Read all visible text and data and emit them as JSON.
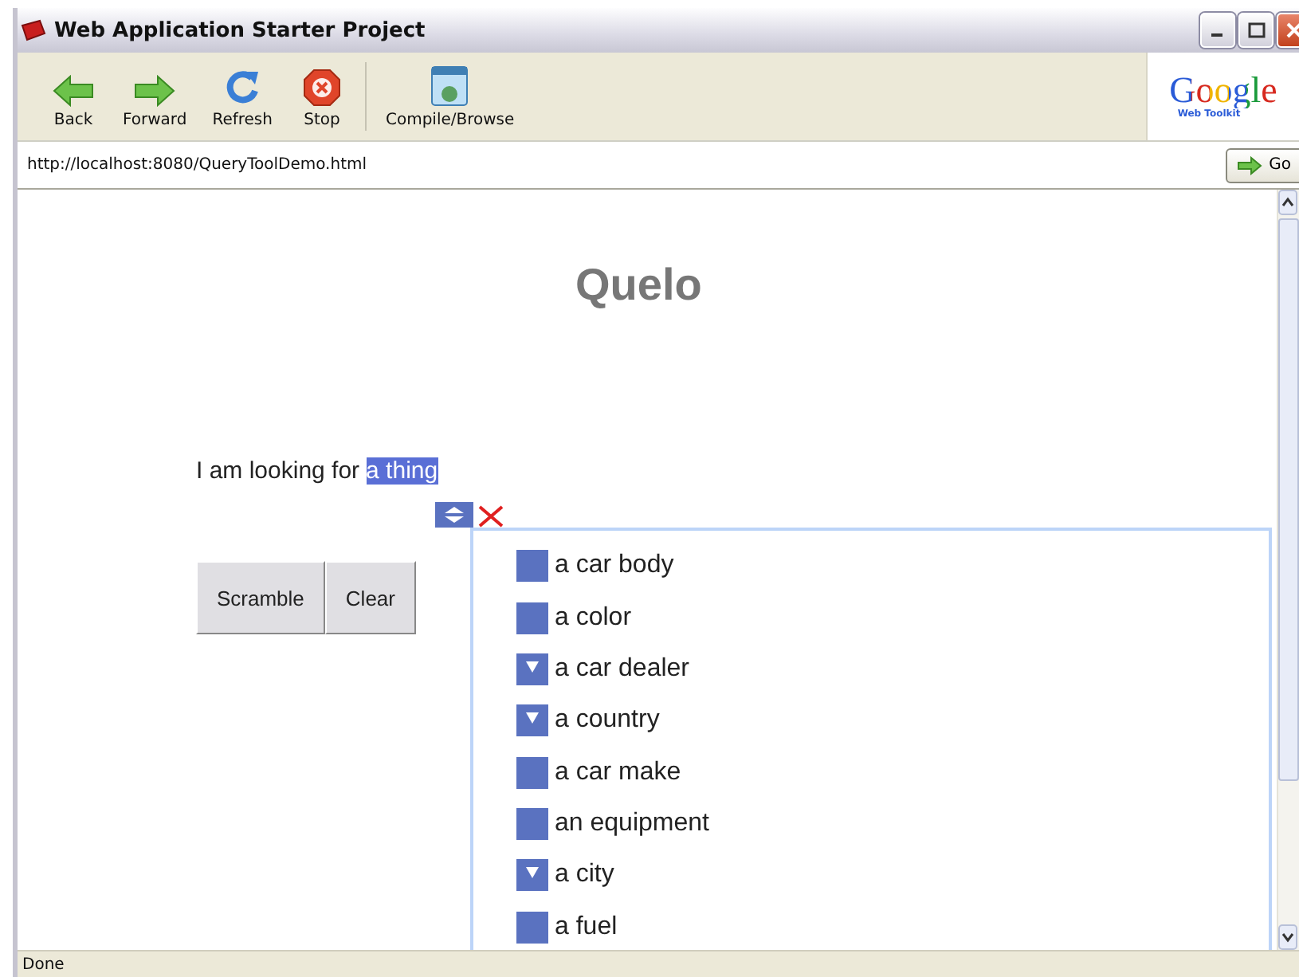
{
  "window": {
    "title": "Web Application Starter Project"
  },
  "toolbar": {
    "buttons": [
      {
        "label": "Back",
        "kind": "back"
      },
      {
        "label": "Forward",
        "kind": "forward"
      },
      {
        "label": "Refresh",
        "kind": "refresh"
      },
      {
        "label": "Stop",
        "kind": "stop"
      },
      {
        "label": "Compile/Browse",
        "kind": "compile"
      }
    ],
    "logo": {
      "name": "Google",
      "subtitle": "Web Toolkit"
    }
  },
  "address_bar": {
    "url": "http://localhost:8080/QueryToolDemo.html",
    "go_label": "Go"
  },
  "page": {
    "heading": "Quelo",
    "sentence": "I am looking for",
    "selection": "a thing",
    "buttons": [
      "Scramble",
      "Clear"
    ],
    "dropdown_expanded": true,
    "dropdown": [
      {
        "label": "a car body",
        "expandable": false
      },
      {
        "label": "a color",
        "expandable": false
      },
      {
        "label": "a car dealer",
        "expandable": true
      },
      {
        "label": "a country",
        "expandable": true
      },
      {
        "label": "a car make",
        "expandable": false
      },
      {
        "label": "an equipment",
        "expandable": false
      },
      {
        "label": "a city",
        "expandable": true
      },
      {
        "label": "a fuel",
        "expandable": false
      }
    ]
  },
  "status_bar": {
    "text": "Done"
  }
}
